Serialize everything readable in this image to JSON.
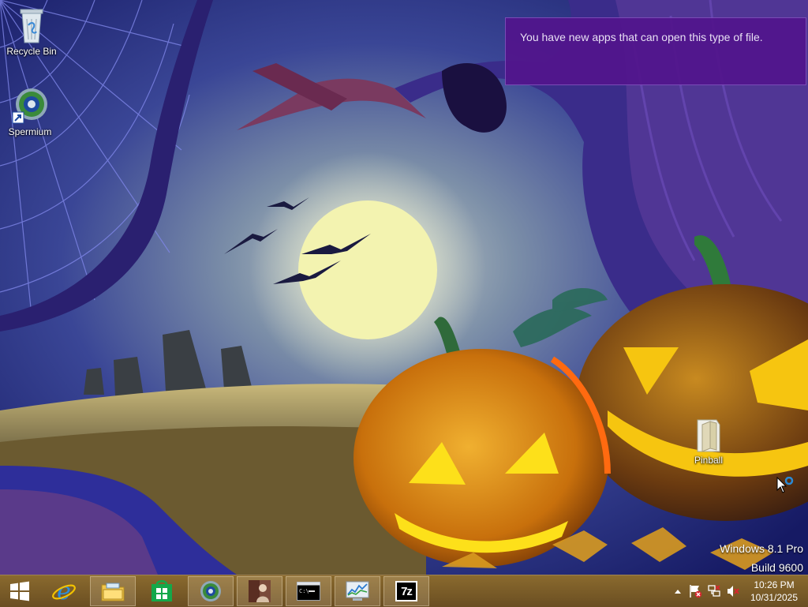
{
  "desktop": {
    "icons": [
      {
        "label": "Recycle Bin"
      },
      {
        "label": "Spermium"
      },
      {
        "label": "Pinball"
      }
    ]
  },
  "notification": {
    "text": "You have new apps that can open this type of file."
  },
  "watermark": {
    "os": "Windows 8.1 Pro",
    "build": "Build 9600"
  },
  "taskbar": {
    "items": [
      {
        "icon": "windows-start-icon"
      },
      {
        "icon": "internet-explorer-icon"
      },
      {
        "icon": "file-explorer-icon"
      },
      {
        "icon": "windows-store-icon"
      },
      {
        "icon": "spermium-app-icon"
      },
      {
        "icon": "image-app-icon"
      },
      {
        "icon": "command-prompt-icon"
      },
      {
        "icon": "resource-monitor-icon"
      },
      {
        "icon": "7zip-icon",
        "text": "7z"
      }
    ],
    "tray": {
      "icons": [
        "show-hidden-icons",
        "action-center-flag-icon",
        "network-icon",
        "volume-muted-icon"
      ],
      "time": "10:26 PM",
      "date": "10/31/2025"
    }
  },
  "colors": {
    "notification_bg": "#52148c",
    "taskbar_bg": "#7a5a28",
    "sky": "#1a1f6e",
    "moon": "#f3f3b0",
    "pumpkin": "#e08a10"
  }
}
